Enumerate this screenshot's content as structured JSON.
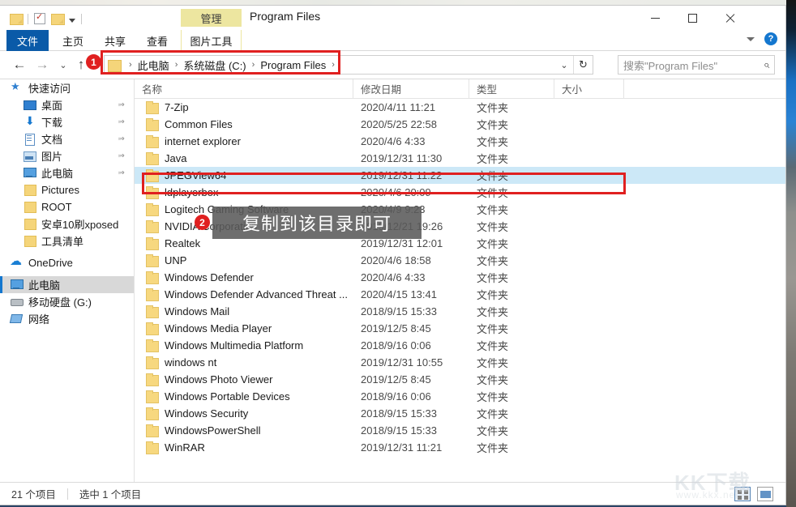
{
  "window": {
    "title": "Program Files",
    "contextual_tab_group": "管理",
    "minimize": "—",
    "maximize": "□",
    "close": "✕"
  },
  "quick_access_toolbar": {
    "items": [
      {
        "name": "folder-icon",
        "label": ""
      },
      {
        "name": "properties-icon",
        "label": ""
      },
      {
        "name": "new-folder-icon",
        "label": ""
      },
      {
        "name": "customize-caret-icon",
        "label": ""
      }
    ]
  },
  "ribbon": {
    "tabs": [
      {
        "id": "file",
        "label": "文件"
      },
      {
        "id": "home",
        "label": "主页"
      },
      {
        "id": "share",
        "label": "共享"
      },
      {
        "id": "view",
        "label": "查看"
      },
      {
        "id": "picture-tools",
        "label": "图片工具"
      }
    ],
    "collapse_label": "⌄",
    "help_label": "?"
  },
  "address_bar": {
    "back": "←",
    "forward": "→",
    "history": "⌄",
    "up": "↑",
    "breadcrumbs": [
      "此电脑",
      "系统磁盘 (C:)",
      "Program Files"
    ],
    "separator": "›",
    "dropdown": "⌄",
    "refresh": "↻"
  },
  "search": {
    "placeholder": "搜索\"Program Files\"",
    "icon": "search-icon"
  },
  "nav_pane": {
    "items": [
      {
        "label": "快速访问",
        "icon": "star-icon",
        "indent": false,
        "pin": false,
        "selected": false
      },
      {
        "label": "桌面",
        "icon": "desktop-icon",
        "indent": true,
        "pin": true,
        "selected": false
      },
      {
        "label": "下载",
        "icon": "download-icon",
        "indent": true,
        "pin": true,
        "selected": false
      },
      {
        "label": "文档",
        "icon": "documents-icon",
        "indent": true,
        "pin": true,
        "selected": false
      },
      {
        "label": "图片",
        "icon": "pictures-icon",
        "indent": true,
        "pin": true,
        "selected": false
      },
      {
        "label": "此电脑",
        "icon": "computer-icon",
        "indent": true,
        "pin": true,
        "selected": false
      },
      {
        "label": "Pictures",
        "icon": "folder-icon",
        "indent": true,
        "pin": false,
        "selected": false
      },
      {
        "label": "ROOT",
        "icon": "folder-icon",
        "indent": true,
        "pin": false,
        "selected": false
      },
      {
        "label": "安卓10刷xposed",
        "icon": "folder-icon",
        "indent": true,
        "pin": false,
        "selected": false
      },
      {
        "label": "工具清单",
        "icon": "folder-icon",
        "indent": true,
        "pin": false,
        "selected": false
      },
      {
        "label": "OneDrive",
        "icon": "cloud-icon",
        "indent": false,
        "pin": false,
        "selected": false
      },
      {
        "label": "此电脑",
        "icon": "computer-icon",
        "indent": false,
        "pin": false,
        "selected": true
      },
      {
        "label": "移动硬盘 (G:)",
        "icon": "drive-icon",
        "indent": false,
        "pin": false,
        "selected": false
      },
      {
        "label": "网络",
        "icon": "network-icon",
        "indent": false,
        "pin": false,
        "selected": false
      }
    ]
  },
  "file_list": {
    "columns": [
      "名称",
      "修改日期",
      "类型",
      "大小"
    ],
    "rows": [
      {
        "name": "7-Zip",
        "date": "2020/4/11 11:21",
        "type": "文件夹",
        "size": "",
        "selected": false
      },
      {
        "name": "Common Files",
        "date": "2020/5/25 22:58",
        "type": "文件夹",
        "size": "",
        "selected": false
      },
      {
        "name": "internet explorer",
        "date": "2020/4/6 4:33",
        "type": "文件夹",
        "size": "",
        "selected": false
      },
      {
        "name": "Java",
        "date": "2019/12/31 11:30",
        "type": "文件夹",
        "size": "",
        "selected": false
      },
      {
        "name": "JPEGView64",
        "date": "2019/12/31 11:22",
        "type": "文件夹",
        "size": "",
        "selected": true
      },
      {
        "name": "ldplayerbox",
        "date": "2020/4/6 20:09",
        "type": "文件夹",
        "size": "",
        "selected": false
      },
      {
        "name": "Logitech Gaming Software",
        "date": "2020/4/9 9:23",
        "type": "文件夹",
        "size": "",
        "selected": false
      },
      {
        "name": "NVIDIA Corporation",
        "date": "2019/12/21 19:26",
        "type": "文件夹",
        "size": "",
        "selected": false
      },
      {
        "name": "Realtek",
        "date": "2019/12/31 12:01",
        "type": "文件夹",
        "size": "",
        "selected": false
      },
      {
        "name": "UNP",
        "date": "2020/4/6 18:58",
        "type": "文件夹",
        "size": "",
        "selected": false
      },
      {
        "name": "Windows Defender",
        "date": "2020/4/6 4:33",
        "type": "文件夹",
        "size": "",
        "selected": false
      },
      {
        "name": "Windows Defender Advanced Threat ...",
        "date": "2020/4/15 13:41",
        "type": "文件夹",
        "size": "",
        "selected": false
      },
      {
        "name": "Windows Mail",
        "date": "2018/9/15 15:33",
        "type": "文件夹",
        "size": "",
        "selected": false
      },
      {
        "name": "Windows Media Player",
        "date": "2019/12/5 8:45",
        "type": "文件夹",
        "size": "",
        "selected": false
      },
      {
        "name": "Windows Multimedia Platform",
        "date": "2018/9/16 0:06",
        "type": "文件夹",
        "size": "",
        "selected": false
      },
      {
        "name": "windows nt",
        "date": "2019/12/31 10:55",
        "type": "文件夹",
        "size": "",
        "selected": false
      },
      {
        "name": "Windows Photo Viewer",
        "date": "2019/12/5 8:45",
        "type": "文件夹",
        "size": "",
        "selected": false
      },
      {
        "name": "Windows Portable Devices",
        "date": "2018/9/16 0:06",
        "type": "文件夹",
        "size": "",
        "selected": false
      },
      {
        "name": "Windows Security",
        "date": "2018/9/15 15:33",
        "type": "文件夹",
        "size": "",
        "selected": false
      },
      {
        "name": "WindowsPowerShell",
        "date": "2018/9/15 15:33",
        "type": "文件夹",
        "size": "",
        "selected": false
      },
      {
        "name": "WinRAR",
        "date": "2019/12/31 11:21",
        "type": "文件夹",
        "size": "",
        "selected": false
      }
    ]
  },
  "status_bar": {
    "item_count": "21 个项目",
    "selection": "选中 1 个项目"
  },
  "annotations": {
    "badge_1": "1",
    "badge_2": "2",
    "tooltip": "复制到该目录即可",
    "accent_color": "#e02020"
  },
  "watermark": {
    "main": "KK下载",
    "sub": "www.kkx.net"
  }
}
